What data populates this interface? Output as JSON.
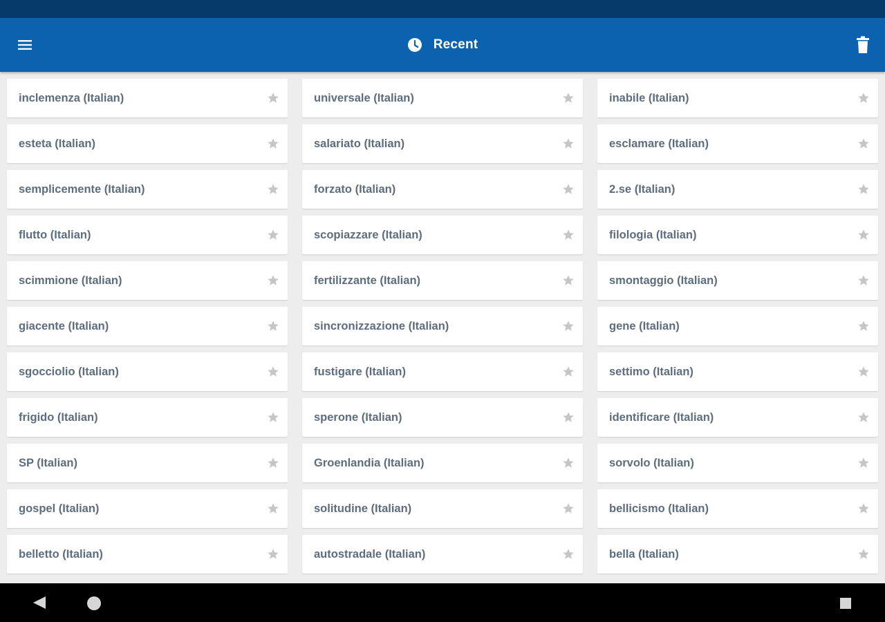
{
  "app_bar": {
    "title": "Recent",
    "title_icon": "clock-icon",
    "menu_icon": "menu-icon",
    "action_icon": "trash-icon",
    "background": "#0b63b0"
  },
  "status_bar": {
    "background": "#053a6b"
  },
  "entries": [
    "inclemenza (Italian)",
    "universale (Italian)",
    "inabile (Italian)",
    "esteta (Italian)",
    "salariato (Italian)",
    "esclamare (Italian)",
    "semplicemente (Italian)",
    "forzato (Italian)",
    "2.se (Italian)",
    "flutto (Italian)",
    "scopiazzare (Italian)",
    "filologia (Italian)",
    "scimmione (Italian)",
    "fertilizzante (Italian)",
    "smontaggio (Italian)",
    "giacente (Italian)",
    "sincronizzazione (Italian)",
    "gene (Italian)",
    "sgocciolio (Italian)",
    "fustigare (Italian)",
    "settimo (Italian)",
    "frigido (Italian)",
    "sperone (Italian)",
    "identificare (Italian)",
    "SP (Italian)",
    "Groenlandia (Italian)",
    "sorvolo (Italian)",
    "gospel (Italian)",
    "solitudine (Italian)",
    "bellicismo (Italian)",
    "belletto (Italian)",
    "autostradale (Italian)",
    "bella (Italian)"
  ],
  "entry_icon": "star-icon",
  "colors": {
    "entry_text": "#5d6d7e",
    "star": "#c6c6c6",
    "page_background": "#ededed"
  },
  "nav_bar": {
    "icons": [
      "back-icon",
      "home-icon",
      "recents-icon"
    ]
  }
}
